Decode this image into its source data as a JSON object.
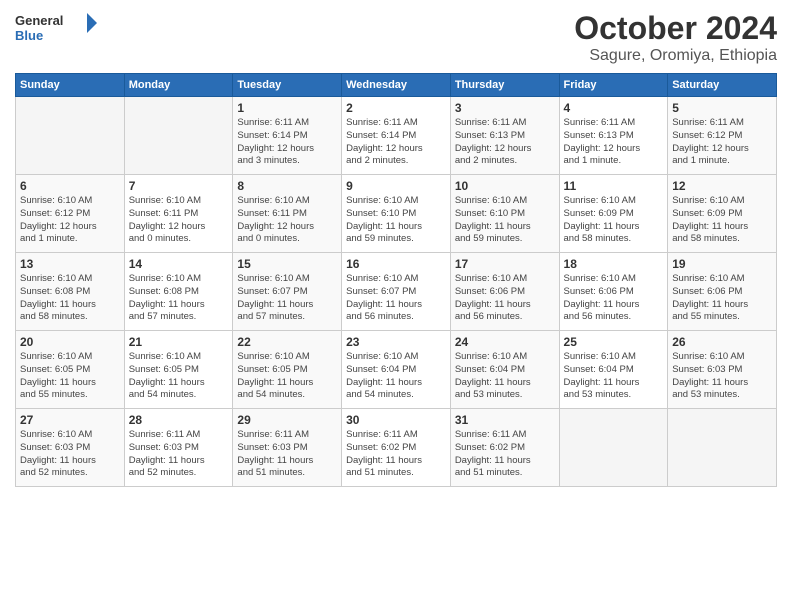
{
  "logo": {
    "general": "General",
    "blue": "Blue"
  },
  "title": "October 2024",
  "subtitle": "Sagure, Oromiya, Ethiopia",
  "days_header": [
    "Sunday",
    "Monday",
    "Tuesday",
    "Wednesday",
    "Thursday",
    "Friday",
    "Saturday"
  ],
  "weeks": [
    [
      {
        "day": "",
        "detail": ""
      },
      {
        "day": "",
        "detail": ""
      },
      {
        "day": "1",
        "detail": "Sunrise: 6:11 AM\nSunset: 6:14 PM\nDaylight: 12 hours\nand 3 minutes."
      },
      {
        "day": "2",
        "detail": "Sunrise: 6:11 AM\nSunset: 6:14 PM\nDaylight: 12 hours\nand 2 minutes."
      },
      {
        "day": "3",
        "detail": "Sunrise: 6:11 AM\nSunset: 6:13 PM\nDaylight: 12 hours\nand 2 minutes."
      },
      {
        "day": "4",
        "detail": "Sunrise: 6:11 AM\nSunset: 6:13 PM\nDaylight: 12 hours\nand 1 minute."
      },
      {
        "day": "5",
        "detail": "Sunrise: 6:11 AM\nSunset: 6:12 PM\nDaylight: 12 hours\nand 1 minute."
      }
    ],
    [
      {
        "day": "6",
        "detail": "Sunrise: 6:10 AM\nSunset: 6:12 PM\nDaylight: 12 hours\nand 1 minute."
      },
      {
        "day": "7",
        "detail": "Sunrise: 6:10 AM\nSunset: 6:11 PM\nDaylight: 12 hours\nand 0 minutes."
      },
      {
        "day": "8",
        "detail": "Sunrise: 6:10 AM\nSunset: 6:11 PM\nDaylight: 12 hours\nand 0 minutes."
      },
      {
        "day": "9",
        "detail": "Sunrise: 6:10 AM\nSunset: 6:10 PM\nDaylight: 11 hours\nand 59 minutes."
      },
      {
        "day": "10",
        "detail": "Sunrise: 6:10 AM\nSunset: 6:10 PM\nDaylight: 11 hours\nand 59 minutes."
      },
      {
        "day": "11",
        "detail": "Sunrise: 6:10 AM\nSunset: 6:09 PM\nDaylight: 11 hours\nand 58 minutes."
      },
      {
        "day": "12",
        "detail": "Sunrise: 6:10 AM\nSunset: 6:09 PM\nDaylight: 11 hours\nand 58 minutes."
      }
    ],
    [
      {
        "day": "13",
        "detail": "Sunrise: 6:10 AM\nSunset: 6:08 PM\nDaylight: 11 hours\nand 58 minutes."
      },
      {
        "day": "14",
        "detail": "Sunrise: 6:10 AM\nSunset: 6:08 PM\nDaylight: 11 hours\nand 57 minutes."
      },
      {
        "day": "15",
        "detail": "Sunrise: 6:10 AM\nSunset: 6:07 PM\nDaylight: 11 hours\nand 57 minutes."
      },
      {
        "day": "16",
        "detail": "Sunrise: 6:10 AM\nSunset: 6:07 PM\nDaylight: 11 hours\nand 56 minutes."
      },
      {
        "day": "17",
        "detail": "Sunrise: 6:10 AM\nSunset: 6:06 PM\nDaylight: 11 hours\nand 56 minutes."
      },
      {
        "day": "18",
        "detail": "Sunrise: 6:10 AM\nSunset: 6:06 PM\nDaylight: 11 hours\nand 56 minutes."
      },
      {
        "day": "19",
        "detail": "Sunrise: 6:10 AM\nSunset: 6:06 PM\nDaylight: 11 hours\nand 55 minutes."
      }
    ],
    [
      {
        "day": "20",
        "detail": "Sunrise: 6:10 AM\nSunset: 6:05 PM\nDaylight: 11 hours\nand 55 minutes."
      },
      {
        "day": "21",
        "detail": "Sunrise: 6:10 AM\nSunset: 6:05 PM\nDaylight: 11 hours\nand 54 minutes."
      },
      {
        "day": "22",
        "detail": "Sunrise: 6:10 AM\nSunset: 6:05 PM\nDaylight: 11 hours\nand 54 minutes."
      },
      {
        "day": "23",
        "detail": "Sunrise: 6:10 AM\nSunset: 6:04 PM\nDaylight: 11 hours\nand 54 minutes."
      },
      {
        "day": "24",
        "detail": "Sunrise: 6:10 AM\nSunset: 6:04 PM\nDaylight: 11 hours\nand 53 minutes."
      },
      {
        "day": "25",
        "detail": "Sunrise: 6:10 AM\nSunset: 6:04 PM\nDaylight: 11 hours\nand 53 minutes."
      },
      {
        "day": "26",
        "detail": "Sunrise: 6:10 AM\nSunset: 6:03 PM\nDaylight: 11 hours\nand 53 minutes."
      }
    ],
    [
      {
        "day": "27",
        "detail": "Sunrise: 6:10 AM\nSunset: 6:03 PM\nDaylight: 11 hours\nand 52 minutes."
      },
      {
        "day": "28",
        "detail": "Sunrise: 6:11 AM\nSunset: 6:03 PM\nDaylight: 11 hours\nand 52 minutes."
      },
      {
        "day": "29",
        "detail": "Sunrise: 6:11 AM\nSunset: 6:03 PM\nDaylight: 11 hours\nand 51 minutes."
      },
      {
        "day": "30",
        "detail": "Sunrise: 6:11 AM\nSunset: 6:02 PM\nDaylight: 11 hours\nand 51 minutes."
      },
      {
        "day": "31",
        "detail": "Sunrise: 6:11 AM\nSunset: 6:02 PM\nDaylight: 11 hours\nand 51 minutes."
      },
      {
        "day": "",
        "detail": ""
      },
      {
        "day": "",
        "detail": ""
      }
    ]
  ]
}
